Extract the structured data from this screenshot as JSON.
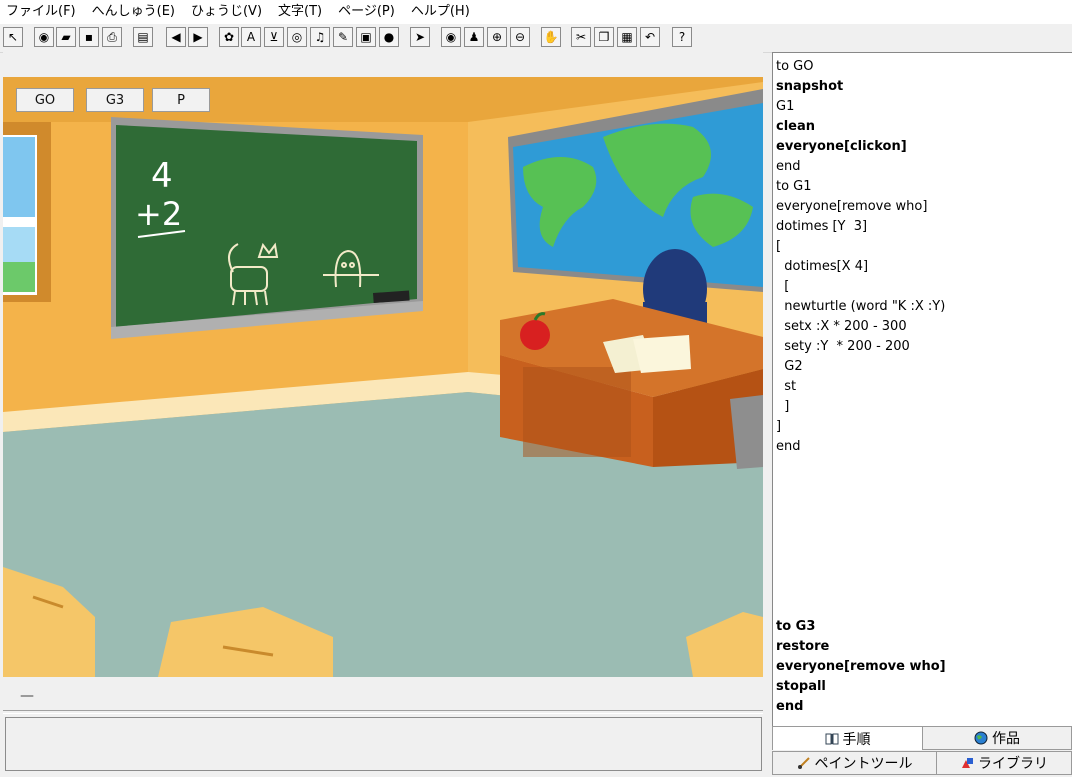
{
  "menu": [
    "ファイル(F)",
    "へんしゅう(E)",
    "ひょうじ(V)",
    "文字(T)",
    "ページ(P)",
    "ヘルプ(H)"
  ],
  "toolbar": {
    "icons": [
      {
        "name": "pointer-select-icon",
        "glyph": "↖"
      },
      {
        "name": "globe-new-icon",
        "glyph": "◉"
      },
      {
        "name": "open-folder-icon",
        "glyph": "▰"
      },
      {
        "name": "save-disk-icon",
        "glyph": "▪"
      },
      {
        "name": "print-icon",
        "glyph": "⎙"
      },
      {
        "name": "page-list-icon",
        "glyph": "▤"
      },
      {
        "name": "arrow-left-icon",
        "glyph": "◀"
      },
      {
        "name": "arrow-right-icon",
        "glyph": "▶"
      },
      {
        "name": "turtle-icon",
        "glyph": "✿"
      },
      {
        "name": "text-box-icon",
        "glyph": "A"
      },
      {
        "name": "slider-icon",
        "glyph": "⊻"
      },
      {
        "name": "eye-button-icon",
        "glyph": "◎"
      },
      {
        "name": "music-note-icon",
        "glyph": "♫"
      },
      {
        "name": "paint-brush-icon",
        "glyph": "✎"
      },
      {
        "name": "video-camera-icon",
        "glyph": "▣"
      },
      {
        "name": "record-icon",
        "glyph": "●"
      },
      {
        "name": "arrow-cursor-icon",
        "glyph": "➤"
      },
      {
        "name": "eye-icon",
        "glyph": "◉"
      },
      {
        "name": "stamp-icon",
        "glyph": "♟"
      },
      {
        "name": "zoom-in-icon",
        "glyph": "⊕"
      },
      {
        "name": "zoom-out-icon",
        "glyph": "⊖"
      },
      {
        "name": "stop-hand-icon",
        "glyph": "✋"
      },
      {
        "name": "cut-icon",
        "glyph": "✂"
      },
      {
        "name": "copy-icon",
        "glyph": "❐"
      },
      {
        "name": "paste-icon",
        "glyph": "▦"
      },
      {
        "name": "undo-icon",
        "glyph": "↶"
      },
      {
        "name": "help-icon",
        "glyph": "?"
      }
    ]
  },
  "stage": {
    "buttons": [
      "GO",
      "G3",
      "P"
    ],
    "chalkboard": {
      "sum_top": "4",
      "sum_bottom": "+2"
    }
  },
  "status": {
    "dash": "—"
  },
  "editor": {
    "lines": [
      {
        "text": "to GO",
        "bold": false
      },
      {
        "text": "snapshot",
        "bold": true
      },
      {
        "text": "G1",
        "bold": false
      },
      {
        "text": "clean",
        "bold": true
      },
      {
        "text": "everyone[clickon]",
        "bold": true
      },
      {
        "text": "end",
        "bold": false
      },
      {
        "text": "to G1",
        "bold": false
      },
      {
        "text": "everyone[remove who]",
        "bold": false
      },
      {
        "text": "dotimes [Y  3]",
        "bold": false
      },
      {
        "text": "[",
        "bold": false
      },
      {
        "text": "  dotimes[X 4]",
        "bold": false
      },
      {
        "text": "  [",
        "bold": false
      },
      {
        "text": "  newturtle (word \"K :X :Y)",
        "bold": false
      },
      {
        "text": "  setx :X * 200 - 300",
        "bold": false
      },
      {
        "text": "  sety :Y  * 200 - 200",
        "bold": false
      },
      {
        "text": "  G2",
        "bold": false
      },
      {
        "text": "  st",
        "bold": false
      },
      {
        "text": "  ]",
        "bold": false
      },
      {
        "text": "]",
        "bold": false
      },
      {
        "text": "end",
        "bold": false
      }
    ],
    "lines2": [
      {
        "text": "to G3",
        "bold": true
      },
      {
        "text": "restore",
        "bold": true
      },
      {
        "text": "everyone[remove who]",
        "bold": true
      },
      {
        "text": "stopall",
        "bold": true
      },
      {
        "text": "end",
        "bold": true
      }
    ]
  },
  "tabs": {
    "procedures": "手順",
    "works": "作品",
    "paint_tool": "ペイントツール",
    "library": "ライブラリ"
  },
  "colors": {
    "wall": "#f4b34a",
    "floor": "#9bbcb3",
    "chalkboard": "#2f6b36",
    "desk": "#c8601e",
    "accent_blue": "#2a5fa8"
  }
}
